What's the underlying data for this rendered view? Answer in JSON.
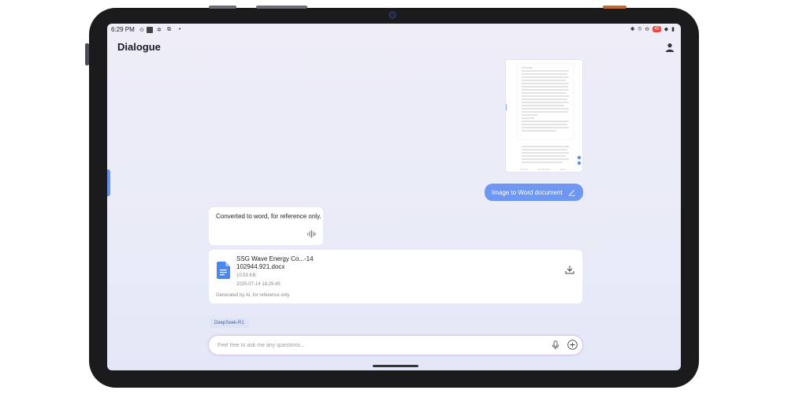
{
  "status_bar": {
    "time": "6:29 PM",
    "notification_badge": "45"
  },
  "page": {
    "title": "Dialogue"
  },
  "chat": {
    "user_message": "Image to Word document",
    "ai_message": "Converted to word, for reference only.",
    "file": {
      "name": "SSG Wave Energy Co...-14 102944.921.docx",
      "size": "10.53 KB",
      "date": "2025-07-14 18:29:45",
      "note": "Generated by AI, for reference only"
    },
    "model": "DeepSeek-R1"
  },
  "input": {
    "placeholder": "Feel free to ask me any questions..."
  },
  "colors": {
    "accent": "#6e96f3",
    "file_icon": "#4a86f0"
  }
}
